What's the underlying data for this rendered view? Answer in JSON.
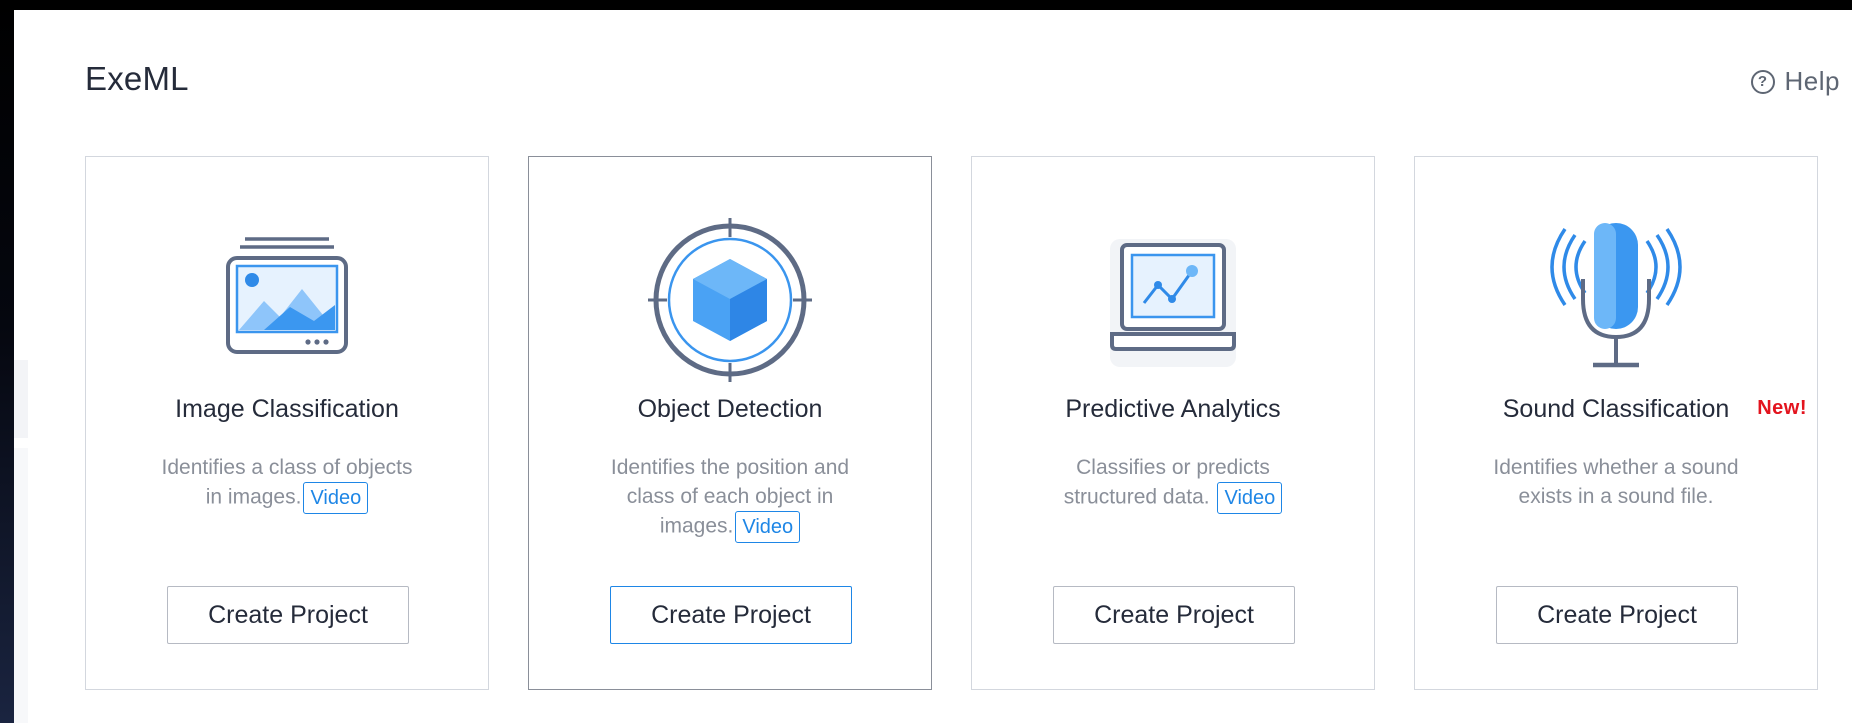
{
  "header": {
    "title": "ExeML",
    "help_label": "Help",
    "help_icon": "question-circle-icon"
  },
  "colors": {
    "accent": "#1e86e6",
    "new_badge": "#e3141e",
    "text_primary": "#252b3a",
    "text_secondary": "#8a8f99"
  },
  "cards": [
    {
      "title": "Image Classification",
      "desc_line1": "Identifies a class of objects",
      "desc_line2": "in images.",
      "video_label": "Video",
      "button_label": "Create Project",
      "icon": "image-classification-icon"
    },
    {
      "title": "Object Detection",
      "desc_line1": "Identifies the position and",
      "desc_line2": "class of each object in",
      "desc_line3": "images.",
      "video_label": "Video",
      "button_label": "Create Project",
      "icon": "object-detection-icon"
    },
    {
      "title": "Predictive Analytics",
      "desc_line1": "Classifies or predicts",
      "desc_line2": "structured data.",
      "video_label": "Video",
      "button_label": "Create Project",
      "icon": "predictive-analytics-icon"
    },
    {
      "title": "Sound Classification",
      "badge": "New!",
      "desc_line1": "Identifies whether a sound",
      "desc_line2": "exists in a sound file.",
      "button_label": "Create Project",
      "icon": "microphone-icon"
    }
  ]
}
